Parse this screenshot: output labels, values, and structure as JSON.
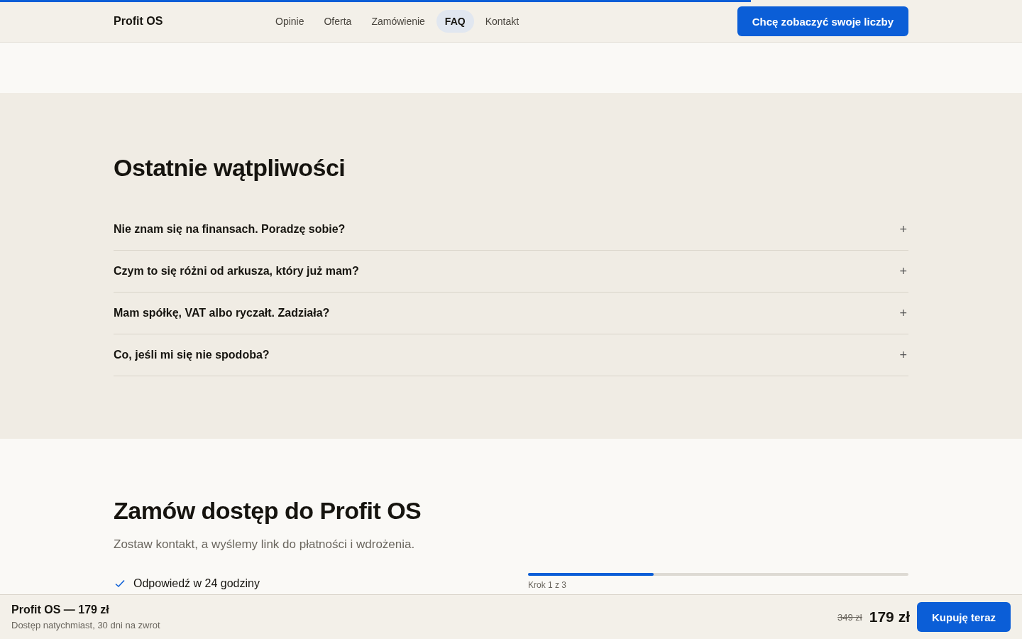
{
  "scroll_progress": {
    "level": 0.735
  },
  "header": {
    "logo": "Profit OS",
    "nav": [
      {
        "label": "Opinie",
        "selected": false
      },
      {
        "label": "Oferta",
        "selected": false
      },
      {
        "label": "Zamówienie",
        "selected": false
      },
      {
        "label": "FAQ",
        "selected": true
      },
      {
        "label": "Kontakt",
        "selected": false
      }
    ],
    "cta": "Chcę zobaczyć swoje liczby"
  },
  "faq": {
    "title": "Ostatnie wątpliwości",
    "items": [
      {
        "question": "Nie znam się na finansach. Poradzę sobie?",
        "expanded": false,
        "toggle": "+"
      },
      {
        "question": "Czym to się różni od arkusza, który już mam?",
        "expanded": false,
        "toggle": "+"
      },
      {
        "question": "Mam spółkę, VAT albo ryczałt. Zadziała?",
        "expanded": false,
        "toggle": "+"
      },
      {
        "question": "Co, jeśli mi się nie spodoba?",
        "expanded": false,
        "toggle": "+"
      }
    ]
  },
  "order": {
    "title": "Zamów dostęp do Profit OS",
    "subtitle": "Zostaw kontakt, a wyślemy link do płatności i wdrożenia.",
    "benefits": [
      "Odpowiedź w 24 godziny"
    ],
    "steps": {
      "level": 0.33,
      "label": "Krok 1 z 3"
    }
  },
  "sticky_bar": {
    "product": "Profit OS — 179 zł",
    "note": "Dostęp natychmiast, 30 dni na zwrot",
    "old_price": "349 zł",
    "price": "179 zł",
    "button": "Kupuję teraz"
  }
}
